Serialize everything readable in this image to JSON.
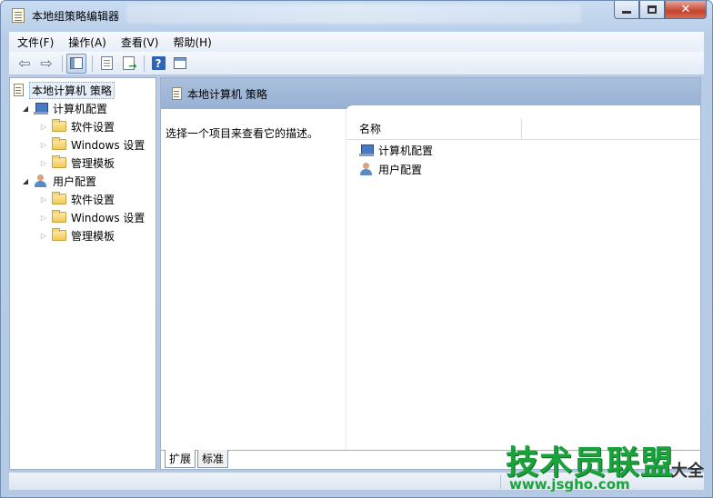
{
  "window": {
    "title": "本地组策略编辑器"
  },
  "menu": {
    "items": [
      "文件(F)",
      "操作(A)",
      "查看(V)",
      "帮助(H)"
    ]
  },
  "toolbar": {
    "buttons": [
      "back-arrow-icon",
      "forward-arrow-icon",
      "show-hide-tree-icon",
      "properties-icon",
      "export-list-icon",
      "help-icon",
      "show-pane-icon"
    ]
  },
  "tree": {
    "root": "本地计算机 策略",
    "computer_config": "计算机配置",
    "user_config": "用户配置",
    "software_settings": "软件设置",
    "windows_settings": "Windows 设置",
    "admin_templates": "管理模板"
  },
  "right_pane": {
    "header_title": "本地计算机 策略",
    "description": "选择一个项目来查看它的描述。",
    "column_name": "名称",
    "items": [
      "计算机配置",
      "用户配置"
    ]
  },
  "tabs": {
    "extended": "扩展",
    "standard": "标准"
  },
  "watermark": {
    "main": "技术员联盟",
    "url": "www.jsgho.com",
    "side": "大全"
  },
  "colors": {
    "header_bar": "#98b1d3",
    "window_frame": "#b8cde8",
    "close_button": "#c4432d",
    "watermark_green": "#1aa33a"
  }
}
